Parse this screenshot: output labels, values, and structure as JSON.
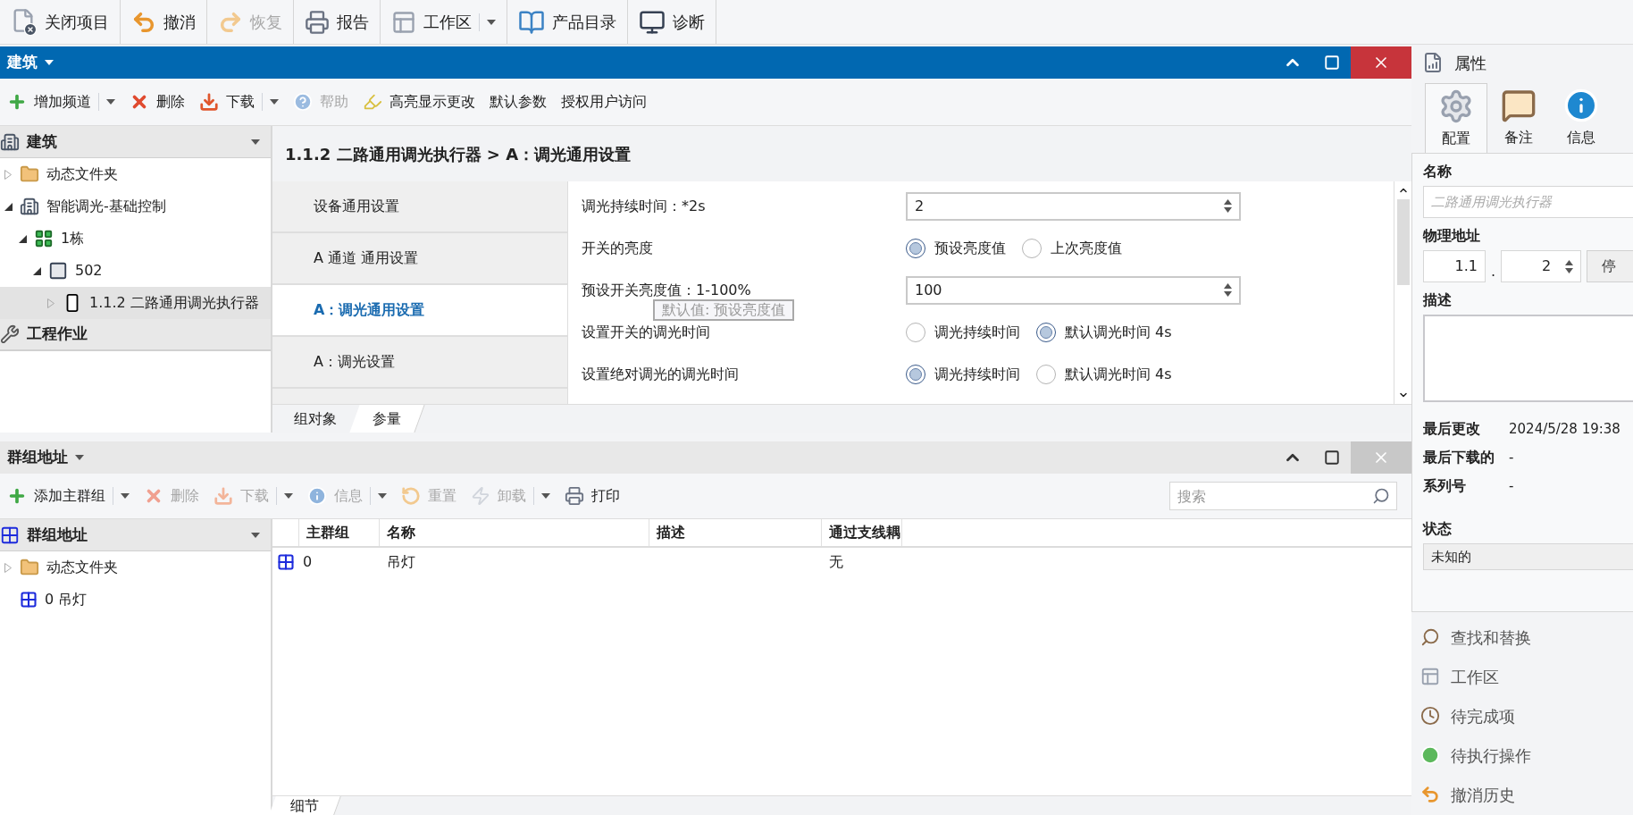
{
  "toolbar": [
    {
      "label": "关闭项目",
      "disabled": false,
      "dropdown": false
    },
    {
      "label": "撤消",
      "disabled": false,
      "dropdown": false
    },
    {
      "label": "恢复",
      "disabled": true,
      "dropdown": false
    },
    {
      "label": "报告",
      "disabled": false,
      "dropdown": false
    },
    {
      "label": "工作区",
      "disabled": false,
      "dropdown": true
    },
    {
      "label": "产品目录",
      "disabled": false,
      "dropdown": false
    },
    {
      "label": "诊断",
      "disabled": false,
      "dropdown": false
    }
  ],
  "building_panel": {
    "title": "建筑",
    "toolbar": [
      {
        "label": "增加频道",
        "disabled": false,
        "dropdown": true
      },
      {
        "label": "删除",
        "disabled": false,
        "dropdown": false
      },
      {
        "label": "下载",
        "disabled": false,
        "dropdown": true
      },
      {
        "label": "帮助",
        "disabled": true,
        "dropdown": false
      },
      {
        "label": "高亮显示更改",
        "disabled": false,
        "dropdown": false
      },
      {
        "label": "默认参数",
        "disabled": false,
        "dropdown": false
      },
      {
        "label": "授权用户访问",
        "disabled": false,
        "dropdown": false
      }
    ],
    "tree_header": "建筑",
    "tree": [
      {
        "kind": "folder",
        "label": "动态文件夹",
        "expanded": false,
        "selected": false
      },
      {
        "kind": "building",
        "label": "智能调光-基础控制",
        "expanded": true,
        "selected": false,
        "children": [
          {
            "kind": "floor",
            "label": "1栋",
            "expanded": true,
            "selected": false,
            "children": [
              {
                "kind": "room",
                "label": "502",
                "expanded": true,
                "selected": false,
                "children": [
                  {
                    "kind": "device",
                    "label": "1.1.2 二路通用调光执行器",
                    "expanded": false,
                    "selected": true
                  }
                ]
              }
            ]
          }
        ]
      }
    ],
    "section": "工程作业",
    "breadcrumb": "1.1.2 二路通用调光执行器 > A：调光通用设置",
    "pages": [
      {
        "label": "设备通用设置",
        "selected": false
      },
      {
        "label": "A 通道 通用设置",
        "selected": false
      },
      {
        "label": "A：调光通用设置",
        "selected": true
      },
      {
        "label": "A：调光设置",
        "selected": false
      }
    ],
    "params": [
      {
        "kind": "spin",
        "label": "调光持续时间：*2s",
        "value": "2"
      },
      {
        "kind": "radio",
        "label": "开关的亮度",
        "options": [
          {
            "label": "预设亮度值",
            "selected": true
          },
          {
            "label": "上次亮度值",
            "selected": false
          }
        ]
      },
      {
        "kind": "spin",
        "label": "预设开关亮度值：1-100%",
        "value": "100"
      },
      {
        "kind": "radio",
        "label": "设置开关的调光时间",
        "options": [
          {
            "label": "调光持续时间",
            "selected": false
          },
          {
            "label": "默认调光时间 4s",
            "selected": true
          }
        ]
      },
      {
        "kind": "radio",
        "label": "设置绝对调光的调光时间",
        "options": [
          {
            "label": "调光持续时间",
            "selected": true
          },
          {
            "label": "默认调光时间 4s",
            "selected": false
          }
        ]
      }
    ],
    "tooltip": "默认值: 预设亮度值",
    "tabs": [
      {
        "label": "组对象",
        "selected": false
      },
      {
        "label": "参量",
        "selected": true
      }
    ]
  },
  "group_panel": {
    "title": "群组地址",
    "toolbar": [
      {
        "label": "添加主群组",
        "disabled": false,
        "dropdown": true
      },
      {
        "label": "删除",
        "disabled": true,
        "dropdown": false
      },
      {
        "label": "下载",
        "disabled": true,
        "dropdown": true
      },
      {
        "label": "信息",
        "disabled": true,
        "dropdown": true
      },
      {
        "label": "重置",
        "disabled": true,
        "dropdown": false
      },
      {
        "label": "卸载",
        "disabled": true,
        "dropdown": true
      },
      {
        "label": "打印",
        "disabled": false,
        "dropdown": false
      }
    ],
    "search": {
      "placeholder": "搜索"
    },
    "tree_header": "群组地址",
    "tree": [
      {
        "kind": "folder",
        "label": "动态文件夹",
        "expanded": false,
        "selected": false
      },
      {
        "kind": "group",
        "label": "0 吊灯",
        "selected": false
      }
    ],
    "columns": [
      "主群组",
      "名称",
      "描述",
      "通过支线耦"
    ],
    "rows": [
      {
        "main_group": "0",
        "name": "吊灯",
        "pass": "无"
      }
    ],
    "tabs": [
      {
        "label": "细节",
        "selected": true
      }
    ]
  },
  "properties": {
    "title": "属性",
    "tabs": [
      {
        "label": "配置",
        "selected": true
      },
      {
        "label": "备注",
        "selected": false
      },
      {
        "label": "信息",
        "selected": false
      }
    ],
    "name_label": "名称",
    "name_placeholder": "二路通用调光执行器",
    "address_label": "物理地址",
    "address_line": "1.1",
    "address_dot": ".",
    "address_device": "2",
    "address_button": "停",
    "description_label": "描述",
    "info": [
      {
        "label": "最后更改",
        "value": "2024/5/28 19:38"
      },
      {
        "label": "最后下载的",
        "value": "-"
      },
      {
        "label": "系列号",
        "value": "-"
      }
    ],
    "status_label": "状态",
    "status": "未知的"
  },
  "side_links": [
    "查找和替换",
    "工作区",
    "待完成项",
    "待执行操作",
    "撤消历史"
  ]
}
